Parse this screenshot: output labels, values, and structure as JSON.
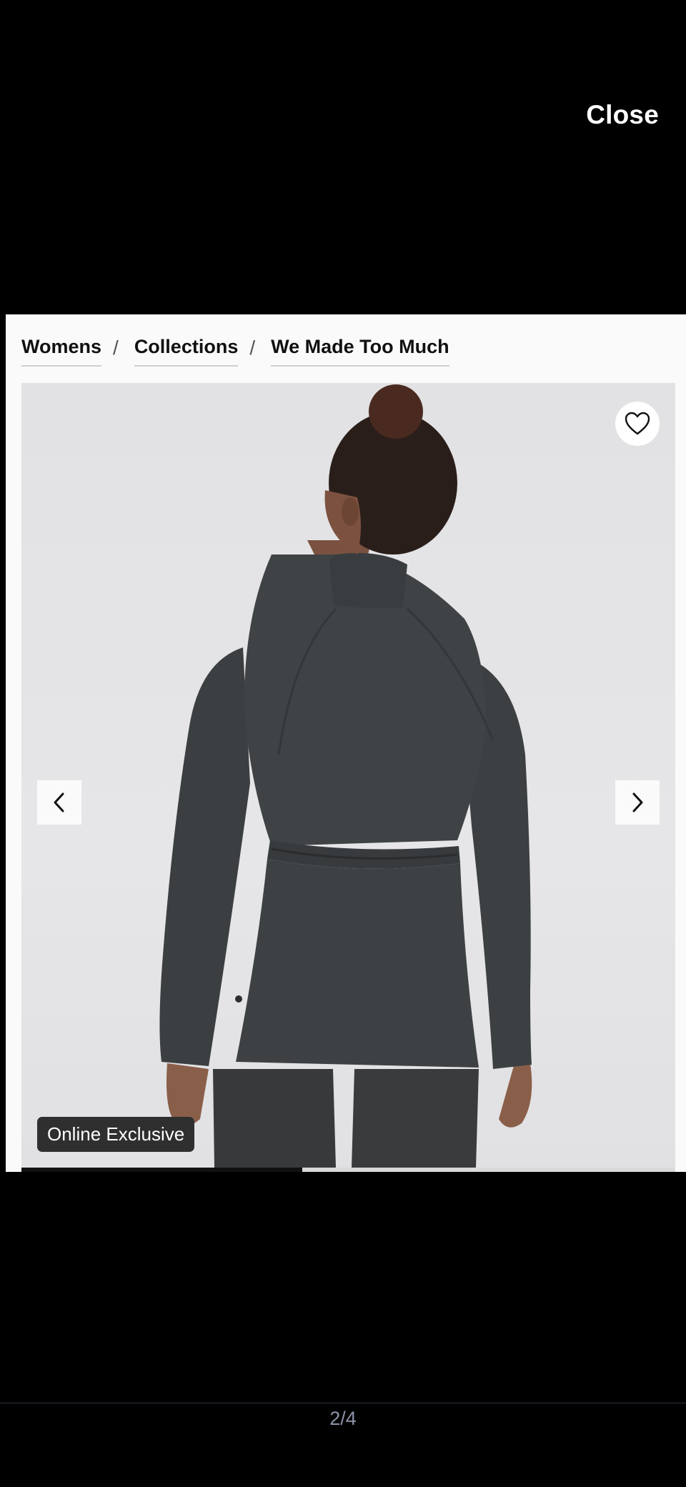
{
  "close_label": "Close",
  "breadcrumb": [
    {
      "label": "Womens"
    },
    {
      "label": "Collections"
    },
    {
      "label": "We Made Too Much"
    }
  ],
  "breadcrumb_separator": "/",
  "gallery": {
    "badge": "Online Exclusive",
    "progress_fraction": 0.43,
    "icons": {
      "wishlist": "heart-icon",
      "previous": "chevron-left-icon",
      "next": "chevron-right-icon"
    }
  },
  "pagination": {
    "counter": "2/4"
  },
  "colors": {
    "background": "#000000",
    "panel": "#fafafa",
    "image_bg": "#e4e4e6",
    "garment": "#3f4244",
    "badge_bg": "#2f2f2f",
    "counter_text": "#8c93a8"
  }
}
